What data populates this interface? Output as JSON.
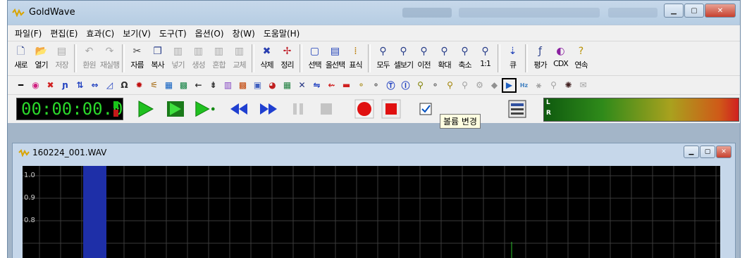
{
  "window": {
    "title": "GoldWave"
  },
  "menu": [
    "파일(F)",
    "편집(E)",
    "효과(C)",
    "보기(V)",
    "도구(T)",
    "옵션(O)",
    "창(W)",
    "도움말(H)"
  ],
  "toolbar": {
    "buttons": [
      {
        "label": "새로",
        "icon": "new-file-icon",
        "enabled": true
      },
      {
        "label": "열기",
        "icon": "open-folder-icon",
        "enabled": true
      },
      {
        "label": "저장",
        "icon": "save-icon",
        "enabled": false
      },
      {
        "label": "환원",
        "icon": "undo-icon",
        "enabled": false
      },
      {
        "label": "재실행",
        "icon": "redo-icon",
        "enabled": false
      },
      {
        "label": "자름",
        "icon": "cut-icon",
        "enabled": true
      },
      {
        "label": "복사",
        "icon": "copy-icon",
        "enabled": true
      },
      {
        "label": "넣기",
        "icon": "paste-icon",
        "enabled": false
      },
      {
        "label": "생성",
        "icon": "paste-new-icon",
        "enabled": false
      },
      {
        "label": "혼합",
        "icon": "mix-icon",
        "enabled": false
      },
      {
        "label": "교체",
        "icon": "replace-icon",
        "enabled": false
      },
      {
        "label": "삭제",
        "icon": "delete-icon",
        "enabled": true
      },
      {
        "label": "정리",
        "icon": "trim-icon",
        "enabled": true
      },
      {
        "label": "선택",
        "icon": "select-icon",
        "enabled": true
      },
      {
        "label": "올선택",
        "icon": "select-all-icon",
        "enabled": true
      },
      {
        "label": "표식",
        "icon": "marker-icon",
        "enabled": true
      },
      {
        "label": "모두",
        "icon": "zoom-all-icon",
        "enabled": true
      },
      {
        "label": "셀보기",
        "icon": "zoom-selection-icon",
        "enabled": true
      },
      {
        "label": "이전",
        "icon": "zoom-previous-icon",
        "enabled": true
      },
      {
        "label": "확대",
        "icon": "zoom-in-icon",
        "enabled": true
      },
      {
        "label": "축소",
        "icon": "zoom-out-icon",
        "enabled": true
      },
      {
        "label": "1:1",
        "icon": "zoom-1-1-icon",
        "enabled": true
      },
      {
        "label": "큐",
        "icon": "cue-icon",
        "enabled": true
      },
      {
        "label": "평가",
        "icon": "expression-evaluator-icon",
        "enabled": true
      },
      {
        "label": "CDX",
        "icon": "cd-extract-icon",
        "enabled": true
      },
      {
        "label": "연속",
        "icon": "batch-help-icon",
        "enabled": true
      }
    ]
  },
  "effects_toolbar": {
    "selected_index": 33,
    "tooltip": "볼륨 변경"
  },
  "control": {
    "time": "00:00:00.0",
    "meter_left_label": "L",
    "meter_right_label": "R"
  },
  "document": {
    "title": "160224_001.WAV",
    "y_labels": [
      "1.0",
      "0.9",
      "0.8"
    ]
  }
}
